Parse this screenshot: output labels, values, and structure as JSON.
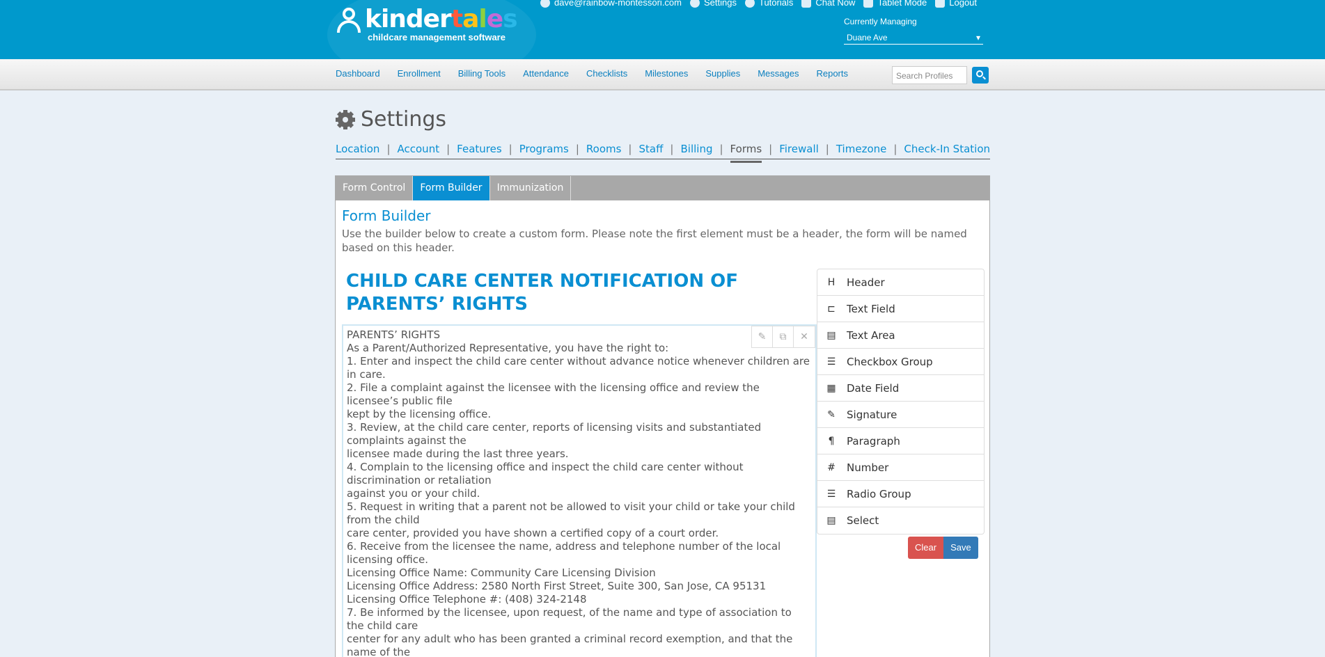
{
  "brand": {
    "logo_word_start": "kinder",
    "logo_word_letters": [
      "t",
      "a",
      "l",
      "e",
      "s"
    ],
    "tagline": "childcare management software"
  },
  "top_links": [
    {
      "label": "dave@rainbow-montessori.com",
      "icon": "user-icon"
    },
    {
      "label": "Settings",
      "icon": "gear-icon"
    },
    {
      "label": "Tutorials",
      "icon": "help-icon"
    },
    {
      "label": "Chat Now",
      "icon": "chat-icon"
    },
    {
      "label": "Tablet Mode",
      "icon": "tablet-icon"
    },
    {
      "label": "Logout",
      "icon": "logout-icon"
    }
  ],
  "managing": {
    "label": "Currently Managing",
    "value": "Duane Ave"
  },
  "nav": [
    "Dashboard",
    "Enrollment",
    "Billing Tools",
    "Attendance",
    "Checklists",
    "Milestones",
    "Supplies",
    "Messages",
    "Reports"
  ],
  "search": {
    "placeholder": "Search Profiles"
  },
  "settings": {
    "title": "Settings",
    "subnav": [
      "Location",
      "Account",
      "Features",
      "Programs",
      "Rooms",
      "Staff",
      "Billing",
      "Forms",
      "Firewall",
      "Timezone",
      "Check-In Station"
    ],
    "active_subnav": "Forms"
  },
  "tabs": [
    {
      "label": "Form Control",
      "active": false
    },
    {
      "label": "Form Builder",
      "active": true
    },
    {
      "label": "Immunization",
      "active": false
    }
  ],
  "form_builder": {
    "title": "Form Builder",
    "description": "Use the builder below to create a custom form. Please note the first element must be a header, the form will be named based on this header.",
    "form_header": "CHILD CARE CENTER NOTIFICATION OF PARENTS’ RIGHTS",
    "paragraph_lines": [
      "PARENTS’ RIGHTS",
      "As a Parent/Authorized Representative, you have the right to:",
      "1. Enter and inspect the child care center without advance notice whenever children are in care.",
      "2. File a complaint against the licensee with the licensing office and review the licensee’s public file",
      "kept by the licensing office.",
      "3. Review, at the child care center, reports of licensing visits and substantiated complaints against the",
      "licensee made during the last three years.",
      "4. Complain to the licensing office and inspect the child care center without discrimination or retaliation",
      "against you or your child.",
      "5. Request in writing that a parent not be allowed to visit your child or take your child from the child",
      "care center, provided you have shown a certified copy of a court order.",
      "6. Receive from the licensee the name, address and telephone number of the local licensing office.",
      "Licensing Office Name: Community Care Licensing Division",
      "Licensing Office Address: 2580 North First Street, Suite 300, San Jose, CA 95131",
      "Licensing Office Telephone #: (408) 324-2148",
      "7. Be informed by the licensee, upon request, of the name and type of association to the child care",
      "center for any adult who has been granted a criminal record exemption, and that the name of the"
    ],
    "palette": [
      {
        "label": "Header",
        "icon": "header-icon",
        "glyph": "H"
      },
      {
        "label": "Text Field",
        "icon": "text-field-icon",
        "glyph": "⊏"
      },
      {
        "label": "Text Area",
        "icon": "text-area-icon",
        "glyph": "▤"
      },
      {
        "label": "Checkbox Group",
        "icon": "checkbox-group-icon",
        "glyph": "☰"
      },
      {
        "label": "Date Field",
        "icon": "calendar-icon",
        "glyph": "▦"
      },
      {
        "label": "Signature",
        "icon": "pencil-icon",
        "glyph": "✎"
      },
      {
        "label": "Paragraph",
        "icon": "paragraph-icon",
        "glyph": "¶"
      },
      {
        "label": "Number",
        "icon": "hash-icon",
        "glyph": "#"
      },
      {
        "label": "Radio Group",
        "icon": "radio-group-icon",
        "glyph": "☰"
      },
      {
        "label": "Select",
        "icon": "select-icon",
        "glyph": "▤"
      }
    ],
    "clear_label": "Clear",
    "save_label": "Save"
  }
}
